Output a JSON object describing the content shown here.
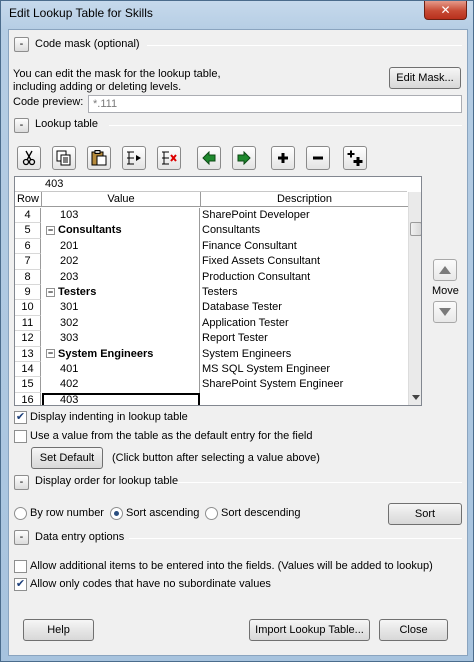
{
  "window": {
    "title": "Edit Lookup Table for Skills",
    "close_glyph": "✕"
  },
  "code_mask": {
    "toggle": "-",
    "header": "Code mask (optional)",
    "desc_line1": "You can edit the mask for the lookup table,",
    "desc_line2": "including adding or deleting levels.",
    "edit_mask_label": "Edit Mask...",
    "preview_label": "Code preview:",
    "preview_value": "*.111"
  },
  "lookup_table": {
    "toggle": "-",
    "header": "Lookup table",
    "toolbar": [
      "scissors-icon",
      "copy-icon",
      "paste-icon",
      "insert-row-icon",
      "delete-row-icon",
      "left-arrow-icon",
      "right-arrow-icon",
      "plus-icon",
      "minus-icon",
      "expand-all-icon"
    ],
    "edit_value": "403",
    "columns": {
      "row": "Row",
      "value": "Value",
      "description": "Description"
    },
    "rows": [
      {
        "num": "4",
        "value": "103",
        "desc": "SharePoint Developer",
        "indent": 1,
        "bold": false,
        "group": false
      },
      {
        "num": "5",
        "value": "Consultants",
        "desc": "Consultants",
        "indent": 0,
        "bold": true,
        "group": true
      },
      {
        "num": "6",
        "value": "201",
        "desc": "Finance Consultant",
        "indent": 1,
        "bold": false,
        "group": false
      },
      {
        "num": "7",
        "value": "202",
        "desc": "Fixed Assets Consultant",
        "indent": 1,
        "bold": false,
        "group": false
      },
      {
        "num": "8",
        "value": "203",
        "desc": "Production Consultant",
        "indent": 1,
        "bold": false,
        "group": false
      },
      {
        "num": "9",
        "value": "Testers",
        "desc": "Testers",
        "indent": 0,
        "bold": true,
        "group": true
      },
      {
        "num": "10",
        "value": "301",
        "desc": "Database Tester",
        "indent": 1,
        "bold": false,
        "group": false
      },
      {
        "num": "11",
        "value": "302",
        "desc": "Application Tester",
        "indent": 1,
        "bold": false,
        "group": false
      },
      {
        "num": "12",
        "value": "303",
        "desc": "Report Tester",
        "indent": 1,
        "bold": false,
        "group": false
      },
      {
        "num": "13",
        "value": "System Engineers",
        "desc": "System Engineers",
        "indent": 0,
        "bold": true,
        "group": true
      },
      {
        "num": "14",
        "value": "401",
        "desc": "MS SQL  System Engineer",
        "indent": 1,
        "bold": false,
        "group": false
      },
      {
        "num": "15",
        "value": "402",
        "desc": "SharePoint System Engineer",
        "indent": 1,
        "bold": false,
        "group": false
      },
      {
        "num": "16",
        "value": "403",
        "desc": "",
        "indent": 1,
        "bold": false,
        "group": false,
        "selected": true
      }
    ],
    "move_label": "Move",
    "display_indenting": "Display indenting in lookup table",
    "use_default": "Use a value from the table as the default entry for the field",
    "set_default_label": "Set Default",
    "set_default_hint": "(Click button after selecting a value above)",
    "display_indenting_checked": true,
    "use_default_checked": false
  },
  "display_order": {
    "toggle": "-",
    "header": "Display order for lookup table",
    "options": [
      "By row number",
      "Sort ascending",
      "Sort descending"
    ],
    "selected": "Sort ascending",
    "sort_label": "Sort"
  },
  "data_entry": {
    "toggle": "-",
    "header": "Data entry options",
    "allow_additional": "Allow additional items to be entered into the fields. (Values will be added to lookup)",
    "allow_only_codes": "Allow only codes that have no subordinate values",
    "allow_additional_checked": false,
    "allow_only_codes_checked": true
  },
  "footer": {
    "help_label": "Help",
    "import_label": "Import Lookup Table...",
    "close_label": "Close"
  }
}
